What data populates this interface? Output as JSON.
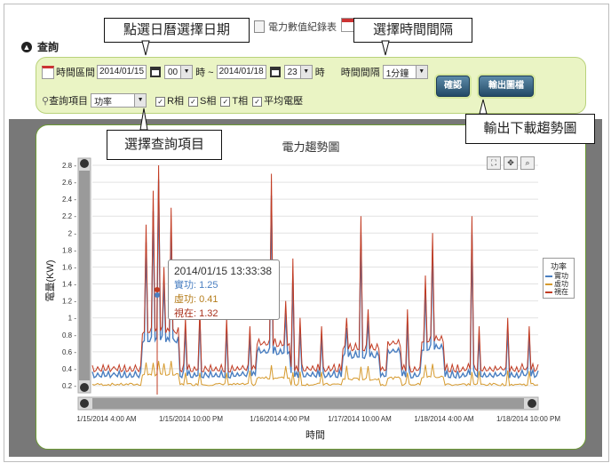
{
  "tabs": {
    "energy_log": "電力數值紀錄表"
  },
  "section": {
    "title": "查詢"
  },
  "filter": {
    "time_range_label": "時間區間",
    "start_date": "2014/01/15",
    "start_hour": "00",
    "hour_unit_1": "時 ~",
    "end_date": "2014/01/18",
    "end_hour": "23",
    "hour_unit_2": "時",
    "interval_label": "時間間隔",
    "interval_value": "1分鐘",
    "item_label": "查詢項目",
    "item_value": "功率",
    "checks": [
      "R相",
      "S相",
      "T相",
      "平均電壓"
    ],
    "confirm_button": "確認",
    "export_button": "輸出圖檔"
  },
  "callouts": {
    "pick_date": "點選日曆選擇日期",
    "pick_interval": "選擇時間間隔",
    "pick_item": "選擇查詢項目",
    "export": "輸出下載趨勢圖"
  },
  "chart_data": {
    "type": "line",
    "title": "電力趨勢圖",
    "xlabel": "時間",
    "ylabel": "電量(KW)",
    "ylim": [
      0.2,
      2.8
    ],
    "yticks": [
      "2.8 -",
      "2.6 -",
      "2.4 -",
      "2.2 -",
      "2 -",
      "1.8 -",
      "1.6 -",
      "1.4 -",
      "1.2 -",
      "1 -",
      "0.8 -",
      "0.6 -",
      "0.4 -",
      "0.2 -"
    ],
    "xticks": [
      "1/15/2014 4:00 AM",
      "1/15/2014 10:00 PM",
      "1/16/2014 4:00 PM",
      "1/17/2014 10:00 AM",
      "1/18/2014 4:00 AM",
      "1/18/2014 10:00 PM"
    ],
    "legend_title": "功率",
    "series": [
      {
        "name": "實功",
        "color": "#4a7fc1"
      },
      {
        "name": "虛功",
        "color": "#d69a2e"
      },
      {
        "name": "視在",
        "color": "#c23b22"
      }
    ],
    "tooltip": {
      "time": "2014/01/15 13:33:38",
      "lines": [
        "實功: 1.25",
        "虛功: 0.41",
        "視在: 1.32"
      ]
    }
  },
  "chart_tools": [
    "⛶",
    "✥",
    "⌕"
  ]
}
